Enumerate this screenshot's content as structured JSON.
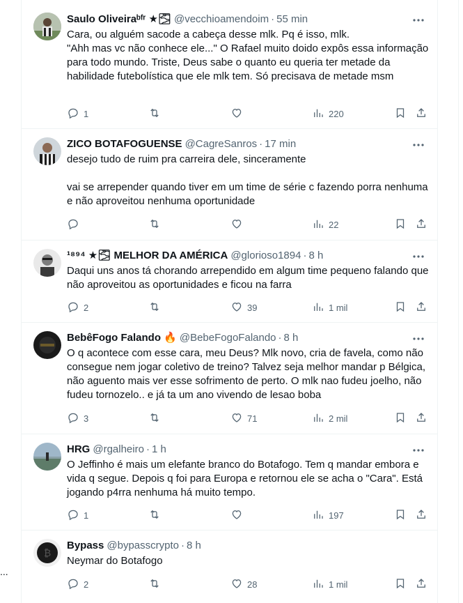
{
  "tweets": [
    {
      "name": "Saulo Oliveiraᵇᶠʳ ★🌫",
      "handle": "@vecchioamendoim",
      "time": "55 min",
      "text": "Cara, ou alguém sacode a cabeça desse mlk. Pq é isso, mlk.\n\"Ahh mas vc não conhece ele...\" O Rafael muito doido expôs essa informação para todo mundo. Triste, Deus sabe o quanto eu queria ter metade da habilidade futebolística que ele mlk tem. Só precisava de metade msm",
      "replies": "1",
      "retweets": "",
      "likes": "",
      "views": "220"
    },
    {
      "name": "ZICO BOTAFOGUENSE",
      "handle": "@CagreSanros",
      "time": "17 min",
      "text": "desejo tudo de ruim pra carreira dele, sinceramente\n\nvai se arrepender quando tiver em um time de série c fazendo porra nenhuma e não aproveitou nenhuma oportunidade",
      "replies": "",
      "retweets": "",
      "likes": "",
      "views": "22"
    },
    {
      "name": "¹⁸⁹⁴ ★🌫 MELHOR DA AMÉRICA",
      "handle": "@glorioso1894",
      "time": "8 h",
      "text": "Daqui uns anos tá chorando arrependido em algum time pequeno falando que não aproveitou as oportunidades e ficou na farra",
      "replies": "2",
      "retweets": "",
      "likes": "39",
      "views": "1 mil"
    },
    {
      "name": "BebêFogo Falando 🔥",
      "handle": "@BebeFogoFalando",
      "time": "8 h",
      "text": "O q acontece com esse cara, meu Deus? Mlk novo, cria de favela, como não consegue nem jogar coletivo de treino? Talvez seja melhor mandar p Bélgica, não aguento mais ver esse sofrimento de perto. O mlk nao fudeu joelho, não fudeu tornozelo.. e já ta um ano vivendo de lesao boba",
      "replies": "3",
      "retweets": "",
      "likes": "71",
      "views": "2 mil"
    },
    {
      "name": "HRG",
      "handle": "@rgalheiro",
      "time": "1 h",
      "text": "O Jeffinho é mais um elefante branco do Botafogo. Tem q mandar embora e vida q segue. Depois q foi para Europa e retornou ele se acha o \"Cara\". Está jogando p4rra nenhuma há muito tempo.",
      "replies": "1",
      "retweets": "",
      "likes": "",
      "views": "197"
    },
    {
      "name": "Bypass",
      "handle": "@bypasscrypto",
      "time": "8 h",
      "text": "Neymar do Botafogo",
      "replies": "2",
      "retweets": "",
      "likes": "28",
      "views": "1 mil"
    }
  ],
  "side_text": "..."
}
